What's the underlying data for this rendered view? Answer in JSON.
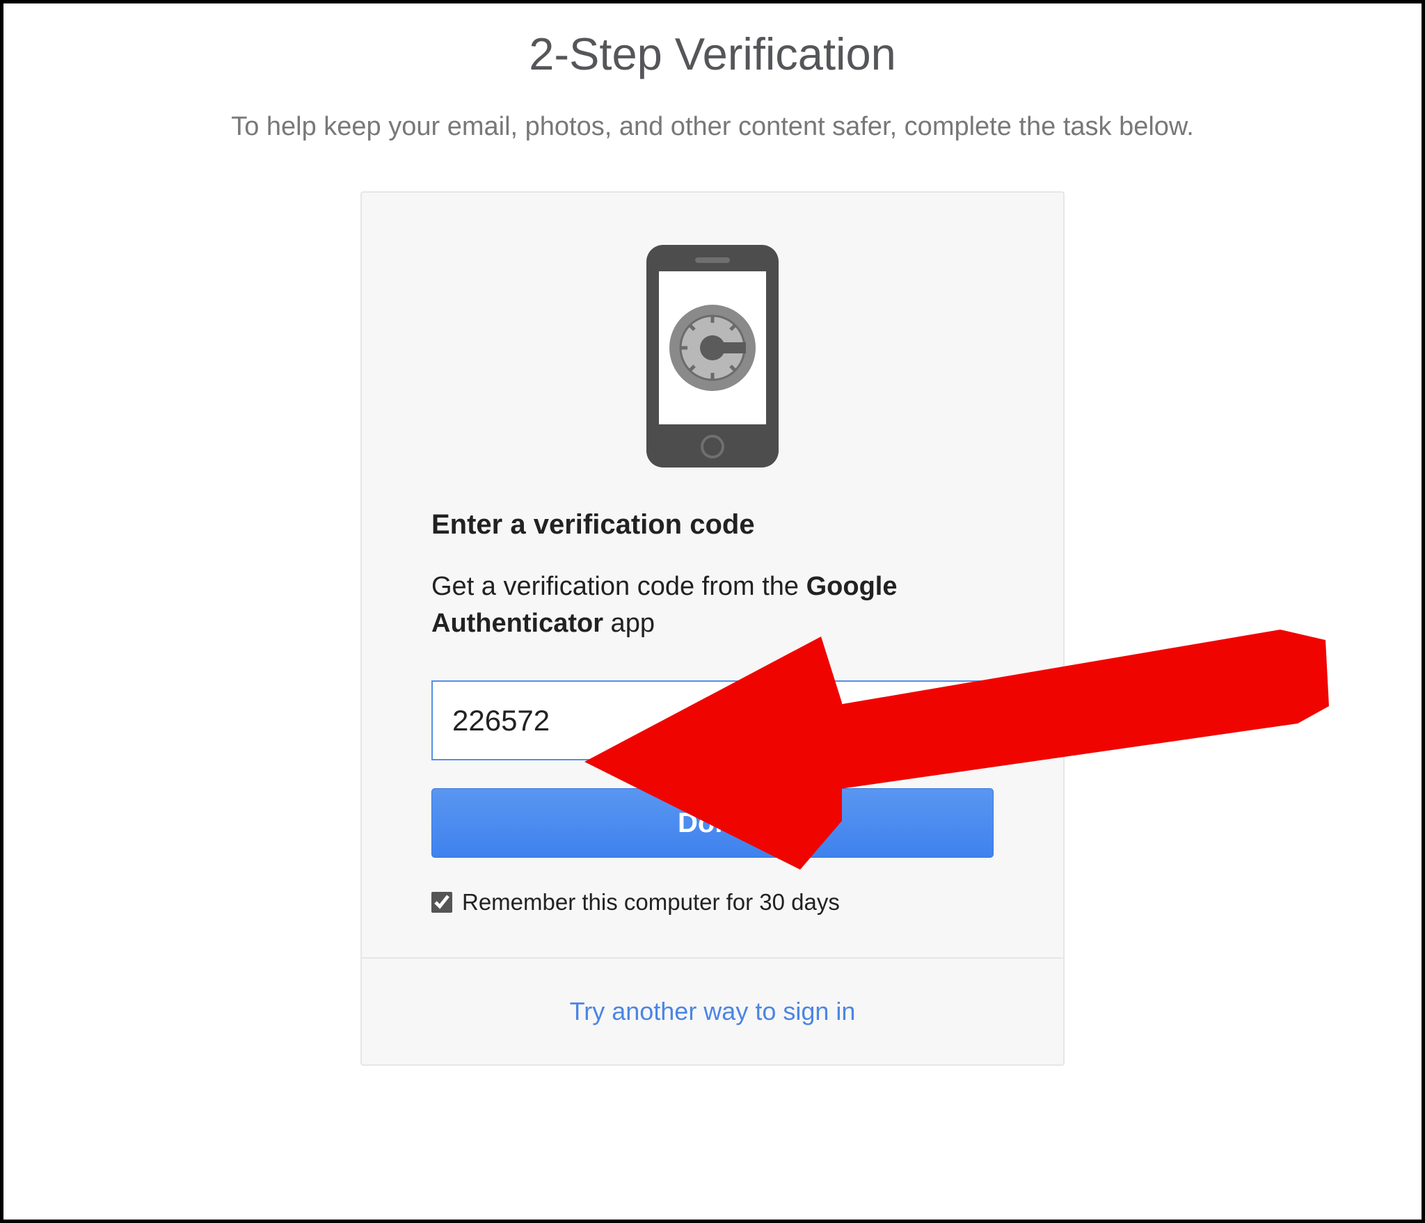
{
  "header": {
    "title": "2-Step Verification",
    "subtitle": "To help keep your email, photos, and other content safer, complete the task below."
  },
  "card": {
    "heading": "Enter a verification code",
    "instruction_prefix": "Get a verification code from the ",
    "instruction_bold": "Google Authenticator",
    "instruction_suffix": " app",
    "code_value": "226572",
    "done_label": "Done",
    "remember_label": "Remember this computer for 30 days",
    "remember_checked": true
  },
  "footer": {
    "alt_link": "Try another way to sign in"
  },
  "icons": {
    "phone": "phone-authenticator-icon"
  },
  "annotation": {
    "arrow_color": "#f00400"
  }
}
